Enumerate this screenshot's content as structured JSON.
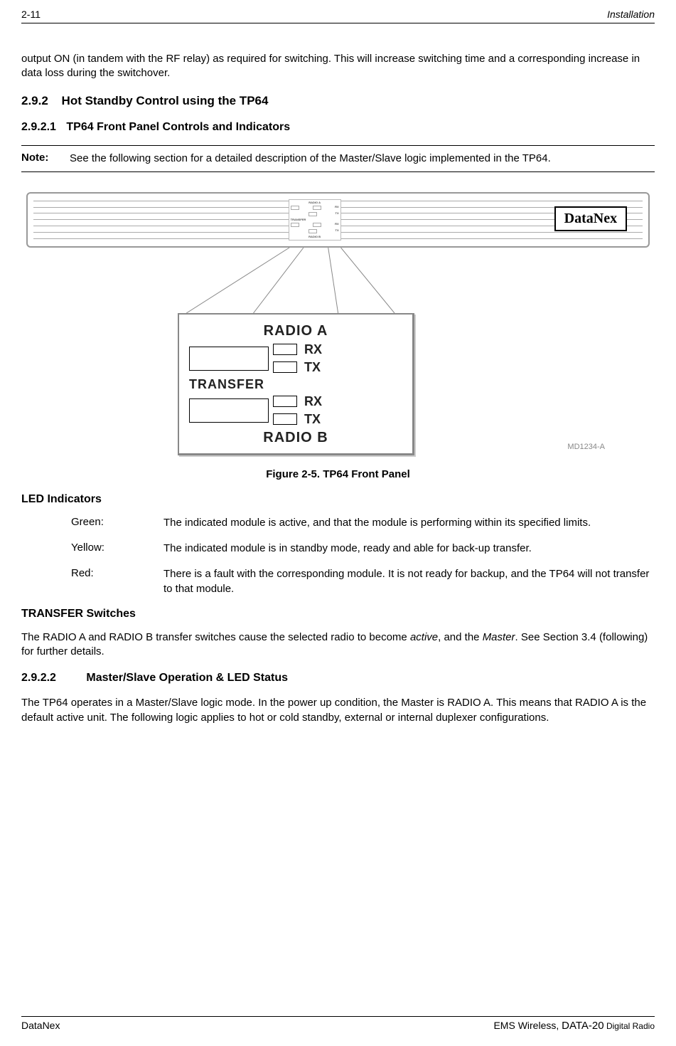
{
  "header": {
    "left": "2-11",
    "right": "Installation"
  },
  "intro_para": "output ON (in tandem with the RF relay) as required for switching.  This will increase switching time and a corresponding increase in data loss during the switchover.",
  "sec292": {
    "num": "2.9.2",
    "title": "Hot Standby Control using the TP64"
  },
  "sec2921": {
    "num": "2.9.2.1",
    "title": "TP64 Front Panel Controls and Indicators"
  },
  "note": {
    "label": "Note:",
    "text": "See the following section for a detailed description of the Master/Slave logic implemented in the TP64."
  },
  "figure": {
    "datanex": "DataNex",
    "panel": {
      "radio_a": "RADIO  A",
      "rx": "RX",
      "tx": "TX",
      "transfer": "TRANSFER",
      "radio_b": "RADIO  B"
    },
    "mini": {
      "radio_a": "RADIO A",
      "rx": "RX",
      "tx": "TX",
      "transfer": "TRANSFER",
      "radio_b": "RADIO B"
    },
    "md_ref": "MD1234-A",
    "caption": "Figure 2-5.  TP64 Front Panel"
  },
  "led_heading": "LED Indicators",
  "indicators": {
    "green": {
      "label": "Green:",
      "text": "The indicated module is active, and that the module is performing within its specified limits."
    },
    "yellow": {
      "label": "Yellow:",
      "text": "The indicated module is in standby mode, ready and able for back-up transfer."
    },
    "red": {
      "label": "Red:",
      "text": "There is a fault with the corresponding module. It is not ready for backup, and the TP64 will not transfer to that module."
    }
  },
  "transfer_heading": "TRANSFER Switches",
  "transfer_para": {
    "p1": "The RADIO A and RADIO B transfer switches cause the selected radio to become ",
    "active": "active",
    "p2": ", and the ",
    "master": "Master",
    "p3": ".  See Section 3.4 (following) for further details."
  },
  "sec2922": {
    "num": "2.9.2.2",
    "title": "Master/Slave Operation & LED Status"
  },
  "ms_para": "The TP64 operates in a Master/Slave logic mode.  In the power up condition, the Master is RADIO A.  This means that RADIO A is the default active unit.  The following logic applies to hot or cold standby, external or internal duplexer configurations.",
  "footer": {
    "left": "DataNex",
    "right_prefix": "EMS Wireless, ",
    "right_big": "DATA-20",
    "right_suffix": " Digital Radio"
  }
}
